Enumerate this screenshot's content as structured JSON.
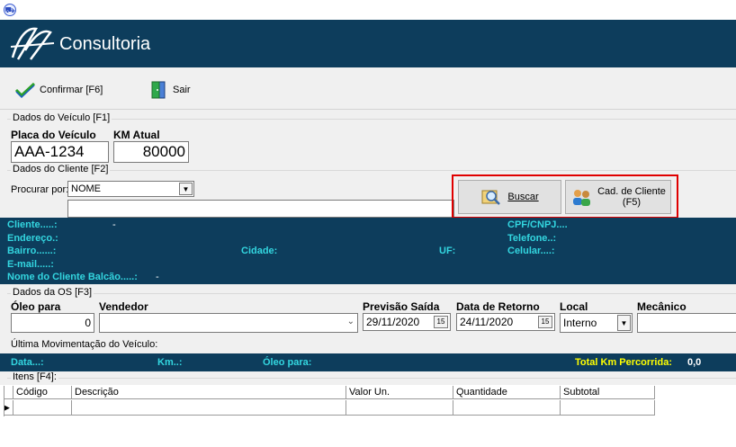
{
  "app": {
    "title": "Consultoria"
  },
  "toolbar": {
    "confirm_label": "Confirmar [F6]",
    "exit_label": "Sair"
  },
  "vehicle": {
    "group_label": "Dados do Veículo [F1]",
    "plate_label": "Placa do Veículo",
    "plate_value": "AAA-1234",
    "km_label": "KM Atual",
    "km_value": "80000"
  },
  "client": {
    "group_label": "Dados do Cliente [F2]",
    "search_by_label": "Procurar por:",
    "search_by_value": "NOME",
    "search_text": "",
    "search_button": "Buscar",
    "register_button": "Cad. de Cliente\n(F5)",
    "fields": {
      "cliente_label": "Cliente.....:",
      "cliente_value": "-",
      "endereco_label": "Endereço.:",
      "bairro_label": "Bairro......:",
      "cidade_label": "Cidade:",
      "uf_label": "UF:",
      "email_label": "E-mail.....:",
      "balcao_label": "Nome do Cliente Balcão.....:",
      "balcao_value": "-",
      "cpf_label": "CPF/CNPJ....",
      "telefone_label": "Telefone..:",
      "celular_label": "Celular....:"
    }
  },
  "os": {
    "group_label": "Dados da OS [F3]",
    "oleo_label": "Óleo para",
    "oleo_value": "0",
    "vendedor_label": "Vendedor",
    "vendedor_value": "",
    "previsao_label": "Previsão Saída",
    "previsao_value": "29/11/2020",
    "retorno_label": "Data de Retorno",
    "retorno_value": "24/11/2020",
    "local_label": "Local",
    "local_value": "Interno",
    "mecanico_label": "Mecânico",
    "mecanico_value": ""
  },
  "last_move": {
    "group_label": "Última Movimentação do Veículo:",
    "data_label": "Data...:",
    "km_label": "Km..:",
    "oleo_label": "Óleo para:",
    "total_label": "Total Km Percorrida:",
    "total_value": "0,0"
  },
  "items": {
    "group_label": "Itens [F4]:",
    "columns": [
      "Código",
      "Descrição",
      "Valor Un.",
      "Quantidade",
      "Subtotal"
    ]
  },
  "colors": {
    "header_bg": "#0d3d5c",
    "label_cyan": "#33d6e0",
    "total_yellow": "#ffff00",
    "highlight_red": "#e00000"
  }
}
